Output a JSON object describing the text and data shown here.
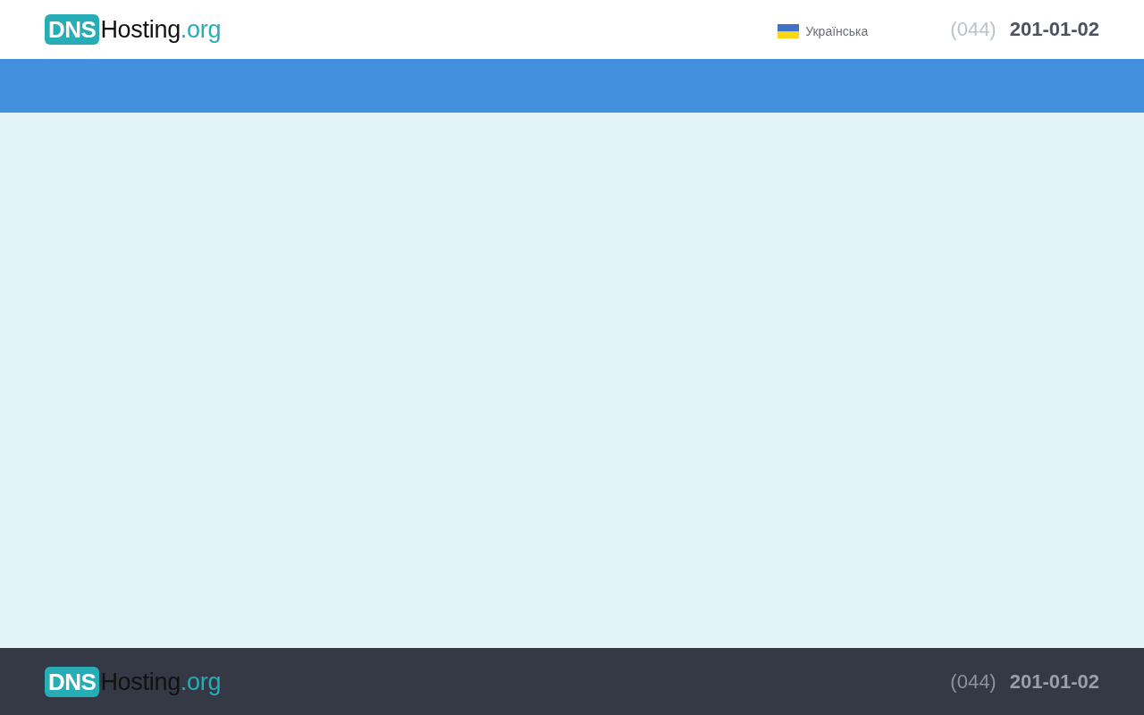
{
  "header": {
    "logo": {
      "badge": "DNS",
      "name": "Hosting",
      "tld": ".org"
    },
    "language": {
      "label": "Українська"
    },
    "phone": {
      "code": "(044)",
      "number": "201-01-02"
    }
  },
  "footer": {
    "logo": {
      "badge": "DNS",
      "name": "Hosting",
      "tld": ".org"
    },
    "phone": {
      "code": "(044)",
      "number": "201-01-02"
    }
  }
}
